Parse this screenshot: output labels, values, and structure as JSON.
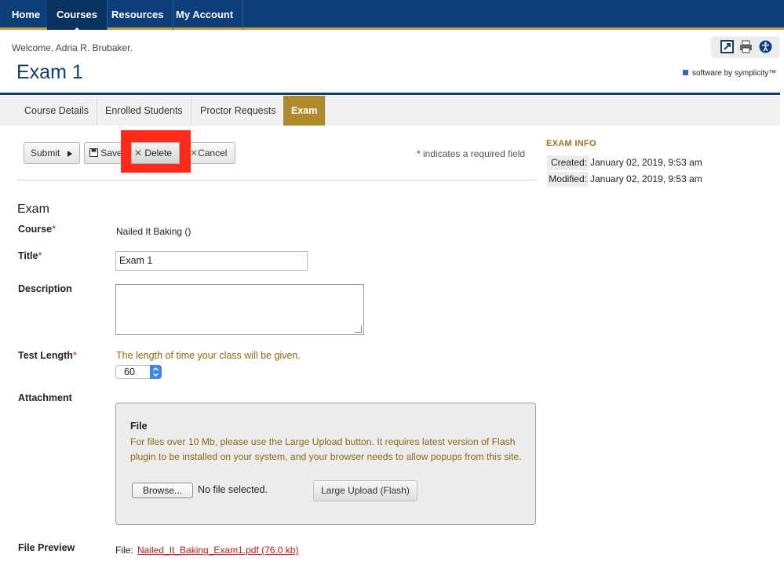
{
  "nav": {
    "items": [
      {
        "label": "Home"
      },
      {
        "label": "Courses",
        "active": true
      },
      {
        "label": "Resources"
      },
      {
        "label": "My Account"
      }
    ]
  },
  "header": {
    "welcome": "Welcome, Adria R. Brubaker.",
    "title": "Exam 1",
    "brand": "software by symplicity™",
    "tool_icons": [
      "popout-icon",
      "print-icon",
      "accessibility-icon"
    ]
  },
  "tabs": [
    {
      "label": "Course Details"
    },
    {
      "label": "Enrolled Students"
    },
    {
      "label": "Proctor Requests"
    },
    {
      "label": "Exam",
      "active": true
    }
  ],
  "toolbar": {
    "submit": "Submit",
    "save": "Save",
    "delete": "Delete",
    "cancel": "Cancel",
    "required_star": "*",
    "required_note": "indicates a required field"
  },
  "exam_info": {
    "heading": "EXAM INFO",
    "created_label": "Created:",
    "created_value": "January 02, 2019, 9:53 am",
    "modified_label": "Modified:",
    "modified_value": "January 02, 2019, 9:53 am"
  },
  "form": {
    "section_title": "Exam",
    "course_label": "Course",
    "course_value": "Nailed It Baking ()",
    "title_label": "Title",
    "title_value": "Exam 1",
    "description_label": "Description",
    "description_value": "",
    "test_length_label": "Test Length",
    "test_length_hint": "The length of time your class will be given.",
    "test_length_value": "60",
    "attachment_label": "Attachment",
    "file_title": "File",
    "file_help": "For files over 10 Mb, please use the Large Upload button. It requires latest version of Flash plugin to be installed on your system, and your browser needs to allow popups from this site.",
    "browse": "Browse...",
    "no_file": "No file selected.",
    "large_upload": "Large Upload (Flash)",
    "file_preview_label": "File Preview",
    "file_preview_prefix": "File:",
    "file_preview_link": "Nailed_It_Baking_Exam1.pdf (76.0 kb)",
    "required_star": "*"
  },
  "colors": {
    "nav_bg": "#0b3e7a",
    "accent_gold": "#b08b2e",
    "highlight_red": "#ff2a1a",
    "link_red": "#c01818"
  }
}
